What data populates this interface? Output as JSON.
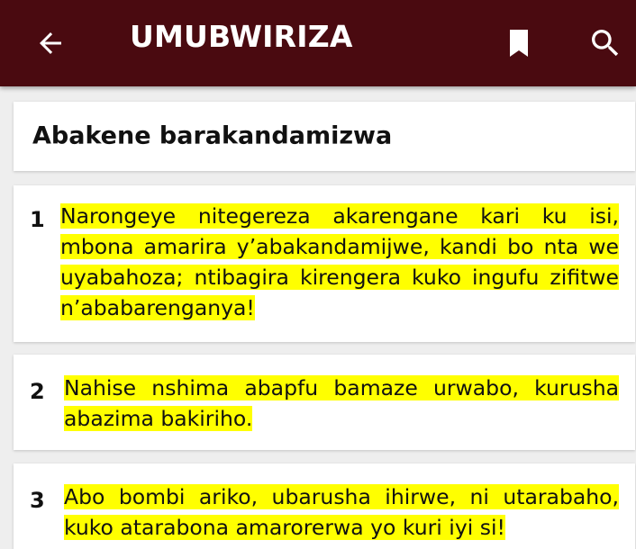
{
  "appbar": {
    "title": "UMUBWIRIZA",
    "back_icon": "arrow-back-icon",
    "bookmark_icon": "bookmark-icon",
    "search_icon": "search-icon",
    "background_color": "#4a0a10"
  },
  "chapter": {
    "heading": "Abakene barakandamizwa"
  },
  "highlight_color": "#ffff00",
  "verses": [
    {
      "number": "1",
      "text": "Narongeye nitegereza akarengane kari ku isi, mbona amarira y’abakandamijwe, kandi bo nta we uyabahoza; ntibagira kirengera kuko ingufu zifitwe n’ababarenganya!"
    },
    {
      "number": "2",
      "text": "Nahise nshima abapfu bamaze urwabo, kurusha abazima bakiriho."
    },
    {
      "number": "3",
      "text": "Abo bombi ariko, ubarusha ihirwe, ni utarabaho, kuko atarabona amarorerwa yo kuri iyi si!"
    }
  ]
}
